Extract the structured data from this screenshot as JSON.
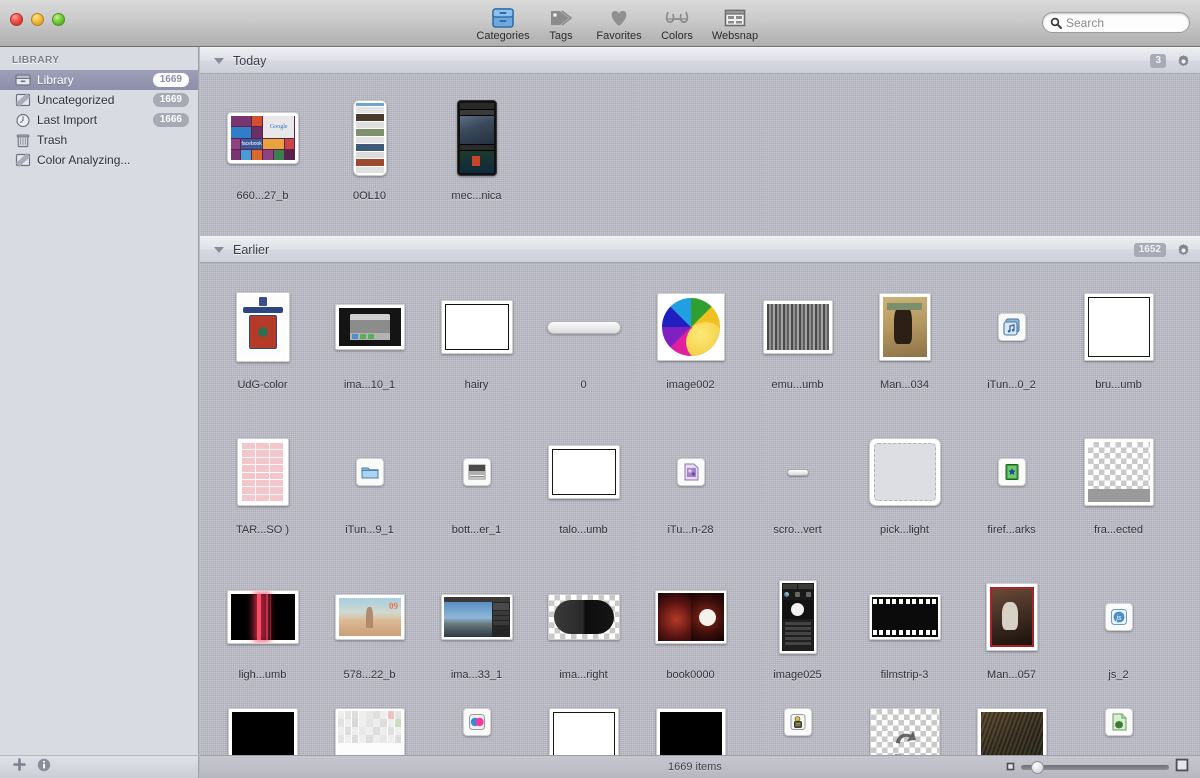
{
  "window": {
    "traffic_lights": [
      "close",
      "minimize",
      "zoom"
    ]
  },
  "toolbar": {
    "items": [
      {
        "label": "Categories",
        "icon": "categories-icon"
      },
      {
        "label": "Tags",
        "icon": "tags-icon"
      },
      {
        "label": "Favorites",
        "icon": "heart-icon"
      },
      {
        "label": "Colors",
        "icon": "glasses-icon"
      },
      {
        "label": "Websnap",
        "icon": "websnap-icon"
      }
    ]
  },
  "search": {
    "placeholder": "Search",
    "value": "",
    "icon": "search-icon"
  },
  "sidebar": {
    "header": "LIBRARY",
    "items": [
      {
        "label": "Library",
        "badge": "1669",
        "icon": "library-icon",
        "selected": true
      },
      {
        "label": "Uncategorized",
        "badge": "1669",
        "icon": "uncategorized-icon",
        "selected": false
      },
      {
        "label": "Last Import",
        "badge": "1666",
        "icon": "clock-icon",
        "selected": false
      },
      {
        "label": "Trash",
        "badge": "",
        "icon": "trash-icon",
        "selected": false
      },
      {
        "label": "Color Analyzing...",
        "badge": "",
        "icon": "color-analyzing-icon",
        "selected": false
      }
    ],
    "footer": {
      "add_label": "+",
      "info_label": "i"
    }
  },
  "status": {
    "items_count": "1669 items",
    "zoom_min_icon": "small-thumbnail-icon",
    "zoom_max_icon": "large-thumbnail-icon",
    "zoom_value": 8
  },
  "sections": [
    {
      "title": "Today",
      "count": "3",
      "gear_icon": "gear-icon",
      "items": [
        {
          "name": "660...27_b",
          "kind": "tablet-ui-screenshot"
        },
        {
          "name": "0OL10",
          "kind": "phone-list-screenshot"
        },
        {
          "name": "mec...nica",
          "kind": "phone-dark-screenshot"
        }
      ]
    },
    {
      "title": "Earlier",
      "count": "1652",
      "gear_icon": "gear-icon",
      "items": [
        {
          "name": "UdG-color",
          "kind": "crest-image"
        },
        {
          "name": "ima...10_1",
          "kind": "dark-app-window"
        },
        {
          "name": "hairy",
          "kind": "white-framed"
        },
        {
          "name": "0",
          "kind": "pill-bar"
        },
        {
          "name": "image002",
          "kind": "colorwheel-lemon"
        },
        {
          "name": "emu...umb",
          "kind": "grey-texture"
        },
        {
          "name": "Man...034",
          "kind": "vintage-poster"
        },
        {
          "name": "iTun...0_2",
          "kind": "itunes-playlist-icon"
        },
        {
          "name": "bru...umb",
          "kind": "white-outlined"
        },
        {
          "name": "TAR...SO )",
          "kind": "pill-grid-sheet"
        },
        {
          "name": "iTun...9_1",
          "kind": "blue-folder-icon"
        },
        {
          "name": "bott...er_1",
          "kind": "grey-window-icon"
        },
        {
          "name": "talo...umb",
          "kind": "white-framed"
        },
        {
          "name": "iTu...n-28",
          "kind": "purple-doc-icon"
        },
        {
          "name": "scro...vert",
          "kind": "scroll-thumb"
        },
        {
          "name": "pick...light",
          "kind": "dashed-light-box"
        },
        {
          "name": "firef...arks",
          "kind": "green-book-icon"
        },
        {
          "name": "fra...ected",
          "kind": "checkerboard"
        },
        {
          "name": "ligh...umb",
          "kind": "red-light-streaks"
        },
        {
          "name": "578...22_b",
          "kind": "beach-photo"
        },
        {
          "name": "ima...33_1",
          "kind": "photo-editor-window"
        },
        {
          "name": "ima...right",
          "kind": "black-pill"
        },
        {
          "name": "book0000",
          "kind": "dark-artwork"
        },
        {
          "name": "image025",
          "kind": "phone-tools-dark"
        },
        {
          "name": "filmstrip-3",
          "kind": "filmstrip"
        },
        {
          "name": "Man...057",
          "kind": "red-bordered-poster"
        },
        {
          "name": "js_2",
          "kind": "js-file-icon"
        },
        {
          "name": "",
          "kind": "black-box"
        },
        {
          "name": "",
          "kind": "periodic-table"
        },
        {
          "name": "",
          "kind": "pink-blue-circles-icon"
        },
        {
          "name": "",
          "kind": "white-framed"
        },
        {
          "name": "",
          "kind": "black-box"
        },
        {
          "name": "",
          "kind": "tiny-sprite-icon"
        },
        {
          "name": "",
          "kind": "share-checker"
        },
        {
          "name": "",
          "kind": "dark-wood-texture"
        },
        {
          "name": "",
          "kind": "green-doc-icon"
        }
      ]
    }
  ]
}
